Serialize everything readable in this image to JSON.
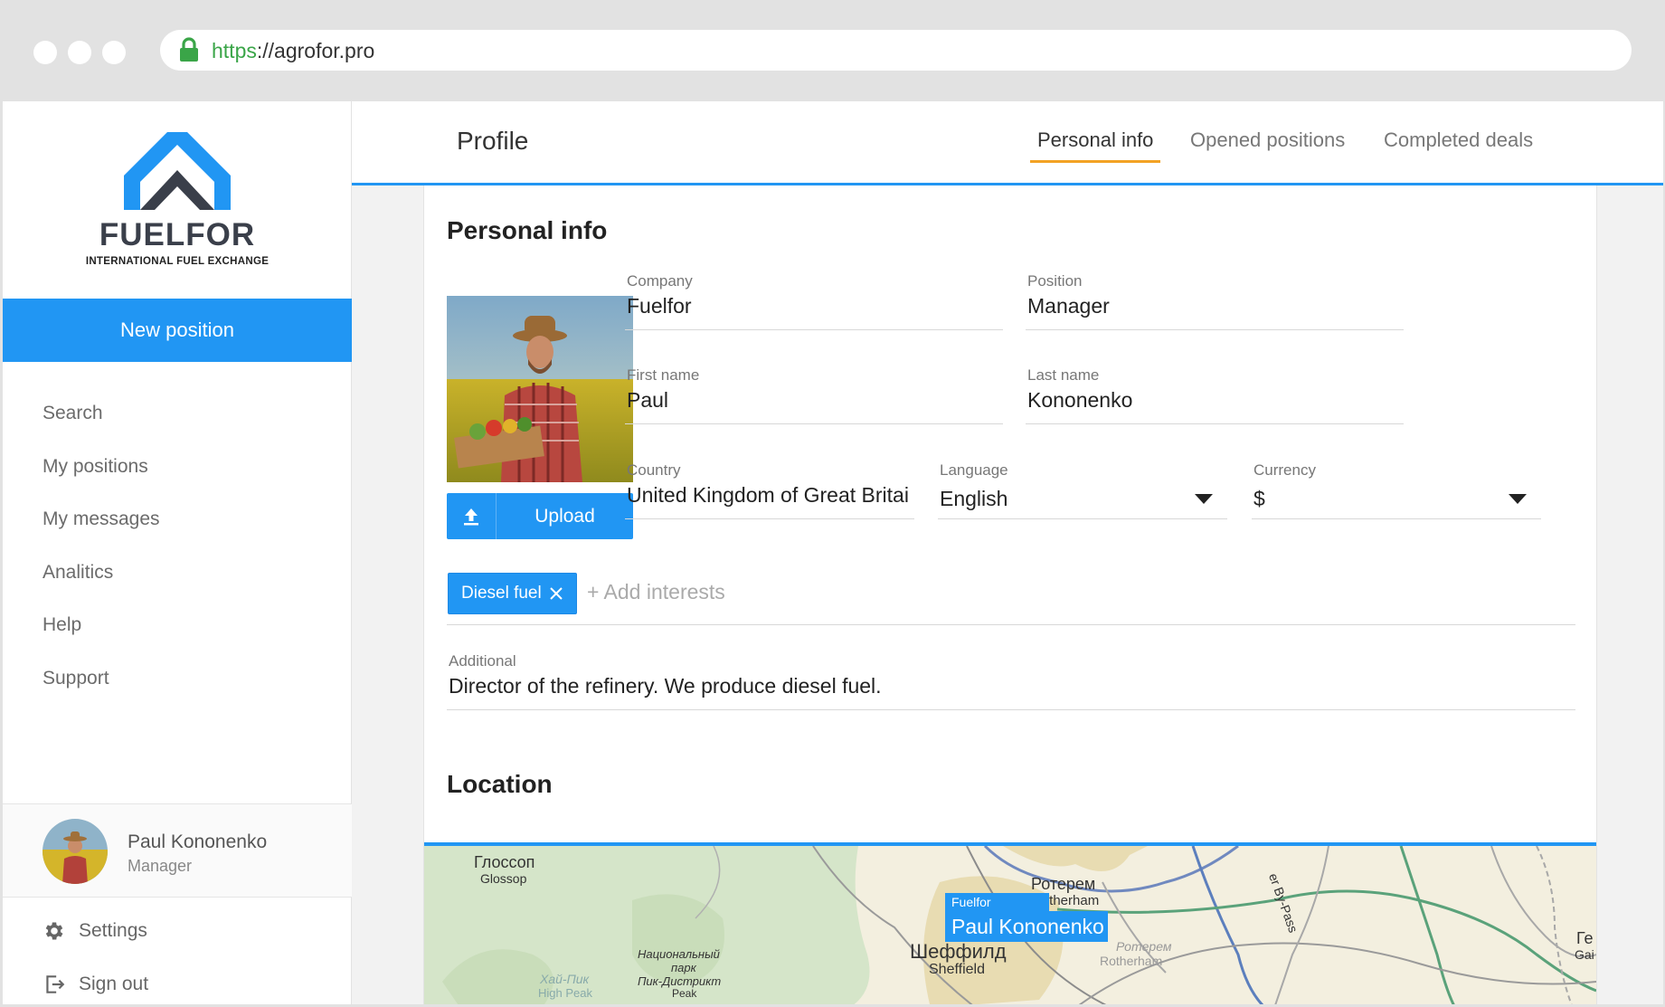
{
  "browser": {
    "url_protocol": "https",
    "url_rest": "://agrofor.pro"
  },
  "brand": {
    "name": "FUELFOR",
    "tagline": "INTERNATIONAL FUEL EXCHANGE",
    "colors": {
      "primary": "#2196f3",
      "dark": "#3a3f4a",
      "accent": "#f3a224"
    }
  },
  "sidebar": {
    "new_position": "New position",
    "items": [
      {
        "label": "Search"
      },
      {
        "label": "My positions"
      },
      {
        "label": "My messages"
      },
      {
        "label": "Analitics"
      },
      {
        "label": "Help"
      },
      {
        "label": "Support"
      }
    ],
    "user": {
      "name": "Paul Kononenko",
      "role": "Manager"
    },
    "settings": {
      "label": "Settings",
      "icon": "gear-icon"
    },
    "signout": {
      "label": "Sign out",
      "icon": "sign-out-icon"
    }
  },
  "header": {
    "title": "Profile",
    "tabs": [
      {
        "label": "Personal info",
        "active": true
      },
      {
        "label": "Opened positions",
        "active": false
      },
      {
        "label": "Completed deals",
        "active": false
      }
    ]
  },
  "personal": {
    "section_title": "Personal info",
    "upload_label": "Upload",
    "company": {
      "label": "Company",
      "value": "Fuelfor"
    },
    "position": {
      "label": "Position",
      "value": "Manager"
    },
    "first_name": {
      "label": "First name",
      "value": "Paul"
    },
    "last_name": {
      "label": "Last name",
      "value": "Kononenko"
    },
    "country": {
      "label": "Country",
      "value": "United Kingdom of Great Britai"
    },
    "language": {
      "label": "Language",
      "value": "English"
    },
    "currency": {
      "label": "Currency",
      "value": "$"
    },
    "interests": [
      {
        "label": "Diesel fuel"
      }
    ],
    "add_interests": "+ Add interests",
    "additional": {
      "label": "Additional",
      "value": "Director of the refinery. We produce diesel fuel."
    }
  },
  "location": {
    "section_title": "Location",
    "marker": {
      "company": "Fuelfor",
      "name": "Paul Kononenko"
    },
    "labels": {
      "glossop_ru": "Глоссоп",
      "glossop_en": "Glossop",
      "rotherham_ru": "Ротерем",
      "rotherham_en": "Rotherham",
      "rotherham_ru2": "Ротерем",
      "rotherham_en2": "Rotherham",
      "sheffield_ru": "Шеффилд",
      "sheffield_en": "Sheffield",
      "park_1": "Национальный",
      "park_2": "парк",
      "park_3": "Пик-Дистрикт",
      "park_4": "Peak",
      "highpeak_ru": "Хай-Пик",
      "highpeak_en": "High Peak",
      "bypass": "er By-Pass",
      "ge": "Ге",
      "ga": "Gai"
    }
  }
}
